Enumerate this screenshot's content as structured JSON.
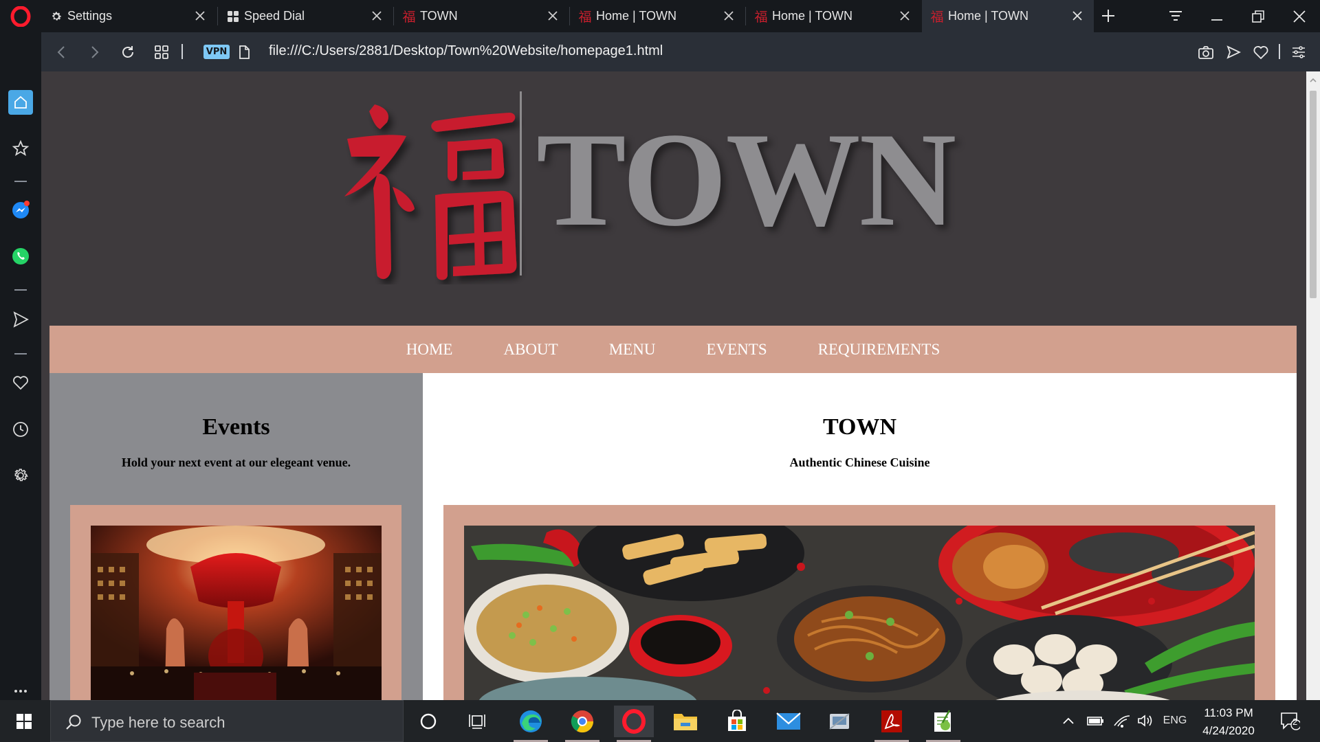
{
  "browser": {
    "tabs": [
      {
        "title": "Settings",
        "icon": "gear-icon"
      },
      {
        "title": "Speed Dial",
        "icon": "speed-dial-icon"
      },
      {
        "title": "TOWN",
        "icon": "fu-favicon"
      },
      {
        "title": "Home | TOWN",
        "icon": "fu-favicon"
      },
      {
        "title": "Home | TOWN",
        "icon": "fu-favicon"
      },
      {
        "title": "Home | TOWN",
        "icon": "fu-favicon",
        "active": true
      }
    ],
    "vpn_label": "VPN",
    "url": "file:///C:/Users/2881/Desktop/Town%20Website/homepage1.html"
  },
  "site": {
    "logo_glyph": "福",
    "logo_word": "TOWN",
    "nav": [
      "HOME",
      "ABOUT",
      "MENU",
      "EVENTS",
      "REQUIREMENTS"
    ],
    "events": {
      "title": "Events",
      "subtitle": "Hold your next event at our elegeant venue."
    },
    "main": {
      "title": "TOWN",
      "subtitle": "Authentic Chinese Cuisine"
    }
  },
  "taskbar": {
    "search_placeholder": "Type here to search",
    "language": "ENG",
    "time": "11:03 PM",
    "date": "4/24/2020",
    "notification_count": "2"
  },
  "colors": {
    "header_bg": "#3e3a3d",
    "accent_salmon": "#d2a08e",
    "logo_red": "#c81f2d",
    "logo_gray": "#8e8d90",
    "left_col_bg": "#8a8b8f",
    "vpn_blue": "#7ec8f5"
  }
}
